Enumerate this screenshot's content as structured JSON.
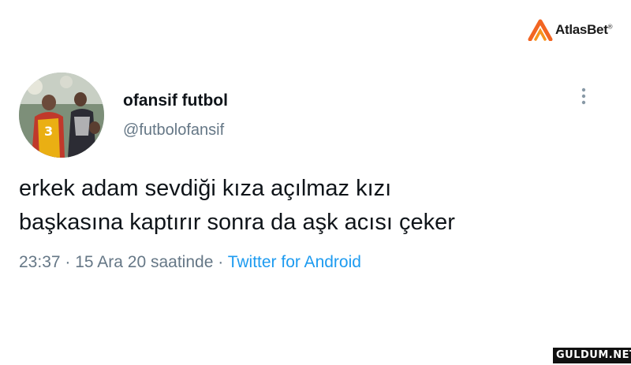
{
  "brand": {
    "name": "AtlasBet",
    "mark": "®",
    "logo_icon": "atlasbet-logo-icon",
    "accent_color": "#f26522"
  },
  "tweet": {
    "avatar_icon": "profile-avatar-photo",
    "display_name": "ofansif futbol",
    "handle": "@futbolofansif",
    "more_icon": "vertical-dots-icon",
    "text_lines": [
      "erkek adam sevdiği kıza açılmaz kızı",
      "başkasına kaptırır sonra da aşk acısı çeker"
    ],
    "time": "23:37",
    "separator": "·",
    "date": "15 Ara 20 saatinde",
    "source": "Twitter for Android",
    "link_color": "#1d9bf0",
    "muted_color": "#657786"
  },
  "watermark": {
    "text": "GULDUM.NET"
  }
}
